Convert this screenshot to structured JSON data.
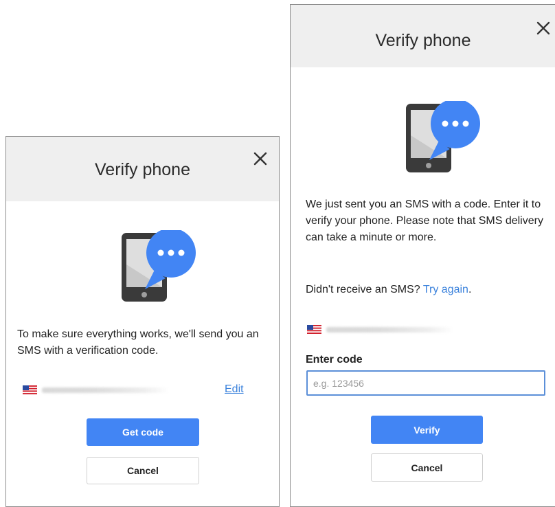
{
  "colors": {
    "accent": "#4285f4",
    "link": "#3b82dc",
    "header_bg": "#efefef",
    "phone_body": "#3a3a3a",
    "bubble": "#4285f4"
  },
  "dialog_send": {
    "title": "Verify phone",
    "close_icon": "close-icon",
    "message": "To make sure everything works, we'll send you an SMS with a verification code.",
    "flag_icon": "us-flag-icon",
    "edit_label": "Edit",
    "get_code_label": "Get code",
    "cancel_label": "Cancel"
  },
  "dialog_verify": {
    "title": "Verify phone",
    "close_icon": "close-icon",
    "message": "We just sent you an SMS with a code. Enter it to verify your phone. Please note that SMS delivery can take a minute or more.",
    "resend_prompt": "Didn't receive an SMS?",
    "try_again_label": "Try again",
    "resend_suffix": ".",
    "flag_icon": "us-flag-icon",
    "code_label": "Enter code",
    "code_placeholder": "e.g. 123456",
    "code_value": "",
    "verify_label": "Verify",
    "cancel_label": "Cancel"
  }
}
